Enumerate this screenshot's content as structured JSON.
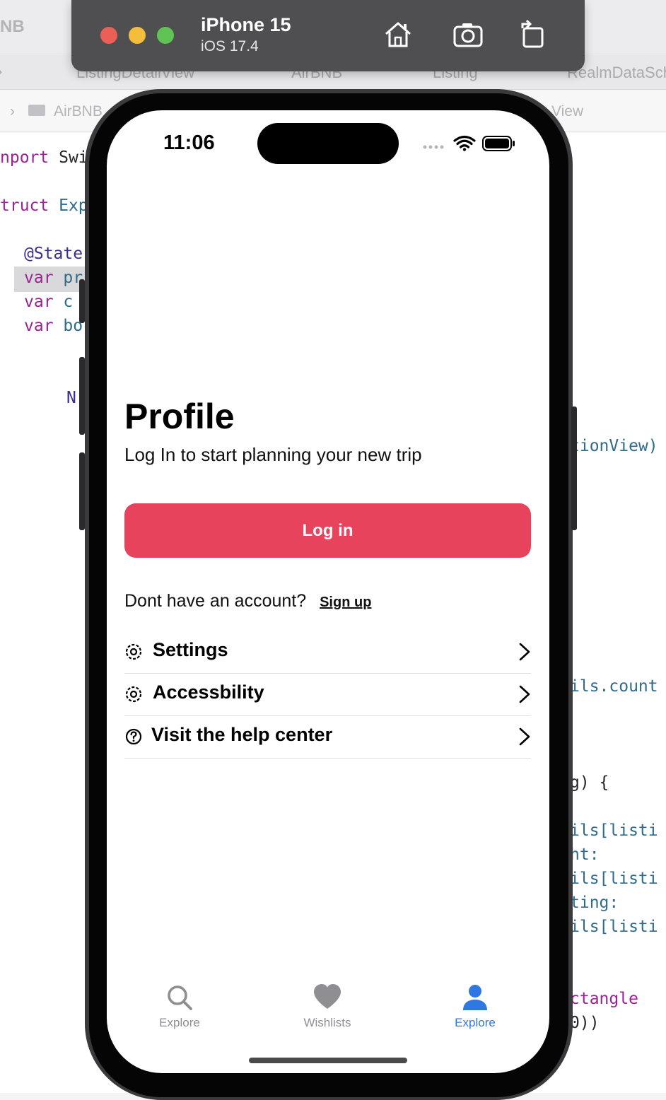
{
  "xcode": {
    "app_name": "NB",
    "tabs": [
      "ListingDetailView",
      "AirBNB",
      "Listing",
      "RealmDataSch"
    ],
    "breadcrumbs": [
      "AirBNB",
      "View"
    ],
    "code_left": [
      {
        "k": "nport",
        "t": " Swi"
      },
      {
        "k": "truct",
        "t": " Exp"
      },
      {
        "k": "@State",
        "t": ""
      },
      {
        "k": "var",
        "t": " pr"
      },
      {
        "k": "var",
        "t": " c"
      },
      {
        "k": "var",
        "t": " bo"
      },
      {
        "k": "",
        "t": "N"
      }
    ],
    "code_right": [
      "tionView)",
      "ils.count",
      "g) {",
      "ils[listi",
      "ht:",
      "ils[listi",
      "ting:",
      "ils[listi",
      "ctangle",
      "0))"
    ]
  },
  "simulator": {
    "device_name": "iPhone 15",
    "os_version": "iOS 17.4",
    "buttons": [
      "home-icon",
      "screenshot-icon",
      "rotate-icon"
    ]
  },
  "status_bar": {
    "time": "11:06"
  },
  "profile": {
    "title": "Profile",
    "subtitle": "Log In to start planning your new trip",
    "login_label": "Log in",
    "signup_prompt": "Dont have an account?",
    "signup_label": "Sign up",
    "accent_color": "#e8435c"
  },
  "menu": [
    {
      "label": "Settings",
      "icon": "gear-icon"
    },
    {
      "label": "Accessbility",
      "icon": "gear-icon"
    },
    {
      "label": "Visit the help center",
      "icon": "help-circle-icon"
    }
  ],
  "tab_bar": [
    {
      "label": "Explore",
      "icon": "search-icon",
      "selected": false
    },
    {
      "label": "Wishlists",
      "icon": "heart-icon",
      "selected": false
    },
    {
      "label": "Explore",
      "icon": "person-icon",
      "selected": true
    }
  ],
  "colors": {
    "tab_selected": "#2f78e4",
    "tab_unselected": "#8e8e93"
  }
}
